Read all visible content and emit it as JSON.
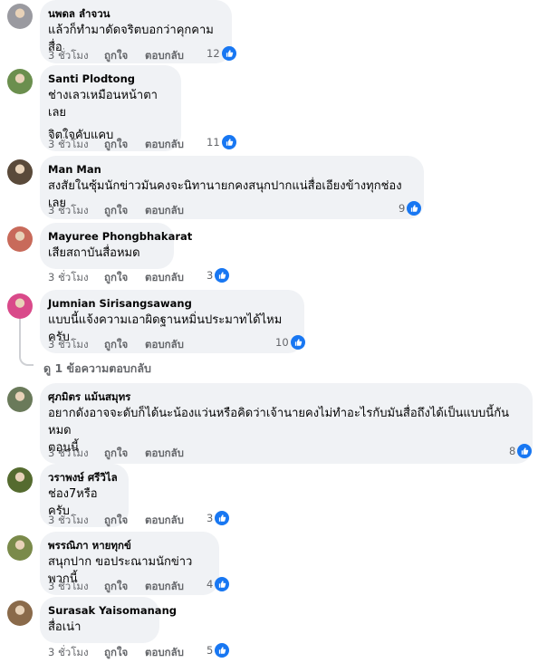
{
  "comments": [
    {
      "author": "นพดล ลำจวน",
      "lines": [
        "แล้วก็ทำมาดัดจริตบอกว่าคุกคามสื่อ"
      ],
      "time": "3 ชั่วโมง",
      "like": "ถูกใจ",
      "reply": "ตอบกลับ",
      "reactions": "12",
      "avatar_color": "#9a9aa0"
    },
    {
      "author": "Santi Plodtong",
      "lines": [
        "ช่างเลวเหมือนหน้าตาเลย",
        "จิตใจคับแคบ"
      ],
      "time": "3 ชั่วโมง",
      "like": "ถูกใจ",
      "reply": "ตอบกลับ",
      "reactions": "11",
      "avatar_color": "#6b8f4e"
    },
    {
      "author": "Man Man",
      "lines": [
        "สงสัยในซุ้มนักข่าวมันคงจะนิทานายกคงสนุกปากแน่สื่อเอียงข้างทุกช่องเลย"
      ],
      "time": "3 ชั่วโมง",
      "like": "ถูกใจ",
      "reply": "ตอบกลับ",
      "reactions": "9",
      "avatar_color": "#5a4a3a"
    },
    {
      "author": "Mayuree Phongbhakarat",
      "lines": [
        "เสียสถาบันสื่อหมด"
      ],
      "time": "3 ชั่วโมง",
      "like": "ถูกใจ",
      "reply": "ตอบกลับ",
      "reactions": "3",
      "avatar_color": "#c86a5a"
    },
    {
      "author": "Jumnian Sirisangsawang",
      "lines": [
        "แบบนี้แจ้งความเอาผิดฐานหมิ่นประมาทได้ไหมครับ"
      ],
      "time": "3 ชั่วโมง",
      "like": "ถูกใจ",
      "reply": "ตอบกลับ",
      "reactions": "10",
      "avatar_color": "#d94a8a"
    },
    {
      "author": "ศุภมิตร แม้นสมุทร",
      "lines": [
        "อยากดังอาจจะดับก็ได้นะน้องแว่นหรือคิดว่าเจ้านายคงไม่ทำอะไรกับมันสื่อถึงได้เป็นแบบนี้กันหมด",
        "ตอนนี้"
      ],
      "time": "3 ชั่วโมง",
      "like": "ถูกใจ",
      "reply": "ตอบกลับ",
      "reactions": "8",
      "avatar_color": "#6a7a5a"
    },
    {
      "author": "วราพงษ์ ศรีวิไล",
      "lines": [
        "ช่อง7หรือครับ"
      ],
      "time": "3 ชั่วโมง",
      "like": "ถูกใจ",
      "reply": "ตอบกลับ",
      "reactions": "3",
      "avatar_color": "#556b2f"
    },
    {
      "author": "พรรณิภา หายทุกข์",
      "lines": [
        "สนุกปาก ขอประณามนักข่าวพวกนี้"
      ],
      "time": "3 ชั่วโมง",
      "like": "ถูกใจ",
      "reply": "ตอบกลับ",
      "reactions": "4",
      "avatar_color": "#7a8a4a"
    },
    {
      "author": "Surasak Yaisomanang",
      "lines": [
        "สื่อเน่า"
      ],
      "time": "3 ชั่วโมง",
      "like": "ถูกใจ",
      "reply": "ตอบกลับ",
      "reactions": "5",
      "avatar_color": "#8a6a4a"
    }
  ],
  "replies_link": "ดู 1 ข้อความตอบกลับ",
  "colors": {
    "reaction_blue": "#1877f2",
    "bubble_bg": "#f0f2f5",
    "meta_gray": "#65676b"
  }
}
